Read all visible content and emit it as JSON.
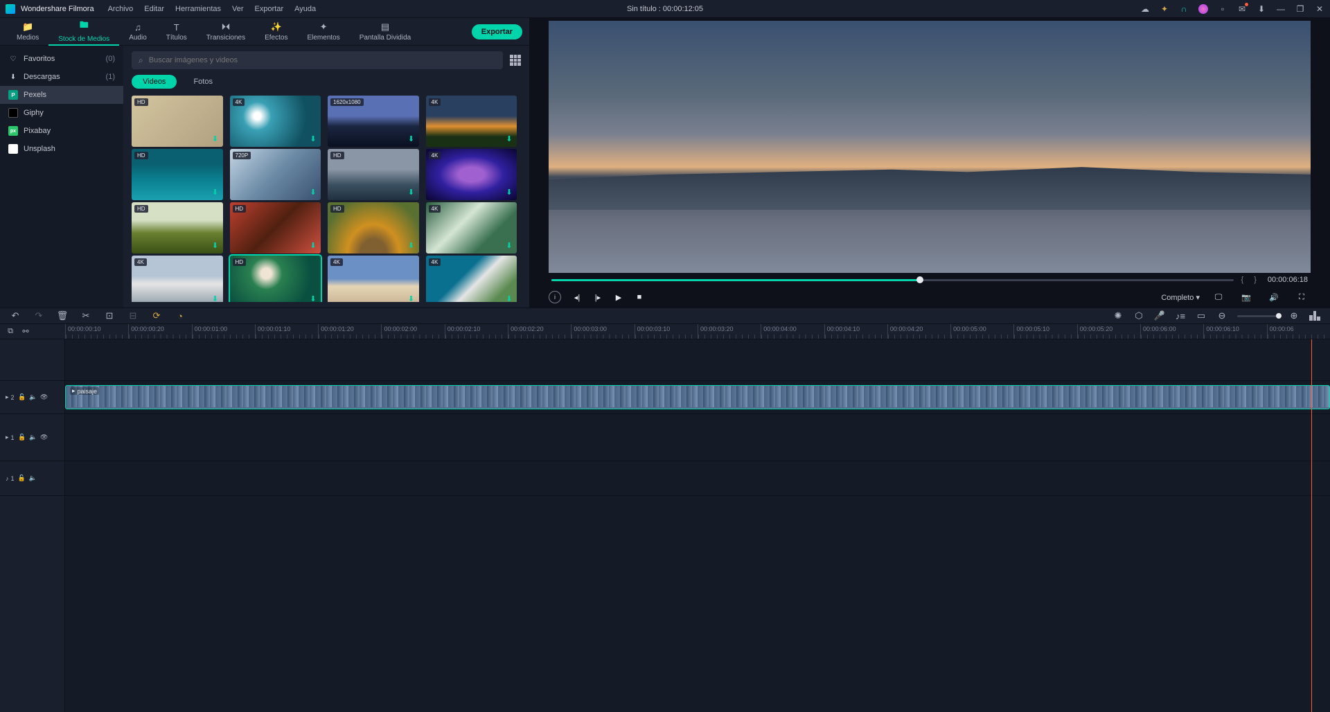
{
  "app_name": "Wondershare Filmora",
  "menu": [
    "Archivo",
    "Editar",
    "Herramientas",
    "Ver",
    "Exportar",
    "Ayuda"
  ],
  "title_center": "Sin título : 00:00:12:05",
  "tool_tabs": [
    {
      "label": "Medios"
    },
    {
      "label": "Stock de Medios"
    },
    {
      "label": "Audio"
    },
    {
      "label": "Títulos"
    },
    {
      "label": "Transiciones"
    },
    {
      "label": "Efectos"
    },
    {
      "label": "Elementos"
    },
    {
      "label": "Pantalla Dividida"
    }
  ],
  "export_label": "Exportar",
  "sidebar": [
    {
      "label": "Favoritos",
      "count": "(0)"
    },
    {
      "label": "Descargas",
      "count": "(1)"
    },
    {
      "label": "Pexels"
    },
    {
      "label": "Giphy"
    },
    {
      "label": "Pixabay"
    },
    {
      "label": "Unsplash"
    }
  ],
  "search_placeholder": "Buscar imágenes y videos",
  "chips": [
    "Videos",
    "Fotos"
  ],
  "thumbs": [
    {
      "badge": "HD",
      "cls": "g-turtle"
    },
    {
      "badge": "4K",
      "cls": "g-wave1"
    },
    {
      "badge": "1620x1080",
      "cls": "g-mtn"
    },
    {
      "badge": "4K",
      "cls": "g-sunset"
    },
    {
      "badge": "HD",
      "cls": "g-reef"
    },
    {
      "badge": "720P",
      "cls": "g-frost"
    },
    {
      "badge": "HD",
      "cls": "g-cliff"
    },
    {
      "badge": "4K",
      "cls": "g-galaxy"
    },
    {
      "badge": "HD",
      "cls": "g-field"
    },
    {
      "badge": "HD",
      "cls": "g-leaf"
    },
    {
      "badge": "HD",
      "cls": "g-road"
    },
    {
      "badge": "4K",
      "cls": "g-falls"
    },
    {
      "badge": "4K",
      "cls": "g-foam"
    },
    {
      "badge": "HD",
      "cls": "g-flower",
      "sel": true
    },
    {
      "badge": "4K",
      "cls": "g-beach"
    },
    {
      "badge": "4K",
      "cls": "g-coast"
    }
  ],
  "preview": {
    "progress_pct": 54,
    "braces": "{   }",
    "time": "00:00:06:18",
    "aspect": "Completo  ▾"
  },
  "ruler_ticks": [
    "00:00:00:10",
    "00:00:00:20",
    "00:00:01:00",
    "00:00:01:10",
    "00:00:01:20",
    "00:00:02:00",
    "00:00:02:10",
    "00:00:02:20",
    "00:00:03:00",
    "00:00:03:10",
    "00:00:03:20",
    "00:00:04:00",
    "00:00:04:10",
    "00:00:04:20",
    "00:00:05:00",
    "00:00:05:10",
    "00:00:05:20",
    "00:00:06:00",
    "00:00:06:10",
    "00:00:06"
  ],
  "tracks": {
    "v2": "2",
    "v1": "1",
    "a1": "1",
    "clip_label": "paisaje"
  },
  "playhead_pct": 98.5
}
